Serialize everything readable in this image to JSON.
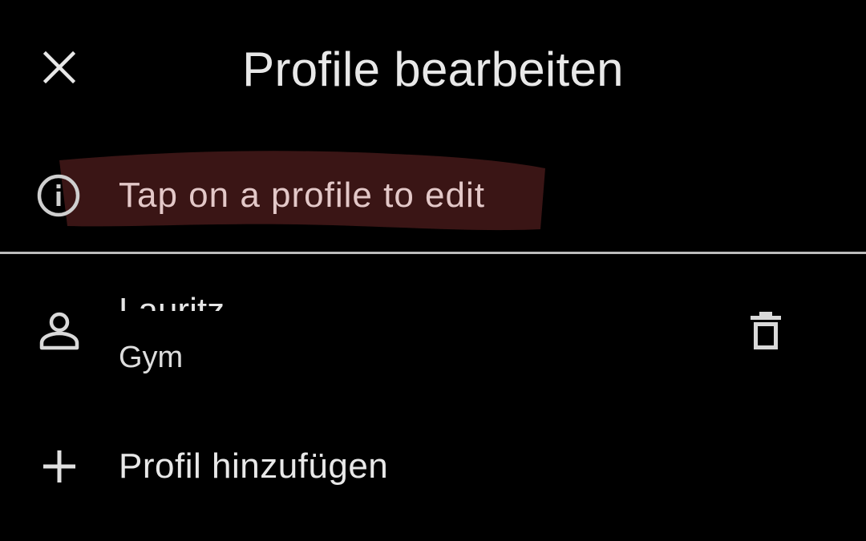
{
  "header": {
    "title": "Profile bearbeiten",
    "close_icon": "close-icon"
  },
  "info": {
    "icon": "info-icon",
    "text": "Tap on a profile to edit",
    "highlight_color": "#3a1515"
  },
  "profiles": [
    {
      "icon": "person-icon",
      "name": "Lauritz",
      "subtitle": "Gym",
      "delete_icon": "trash-icon"
    }
  ],
  "add_profile": {
    "icon": "plus-icon",
    "label": "Profil hinzufügen"
  },
  "colors": {
    "background": "#000000",
    "text": "#e6e6e6",
    "divider": "#bdbdbd"
  }
}
